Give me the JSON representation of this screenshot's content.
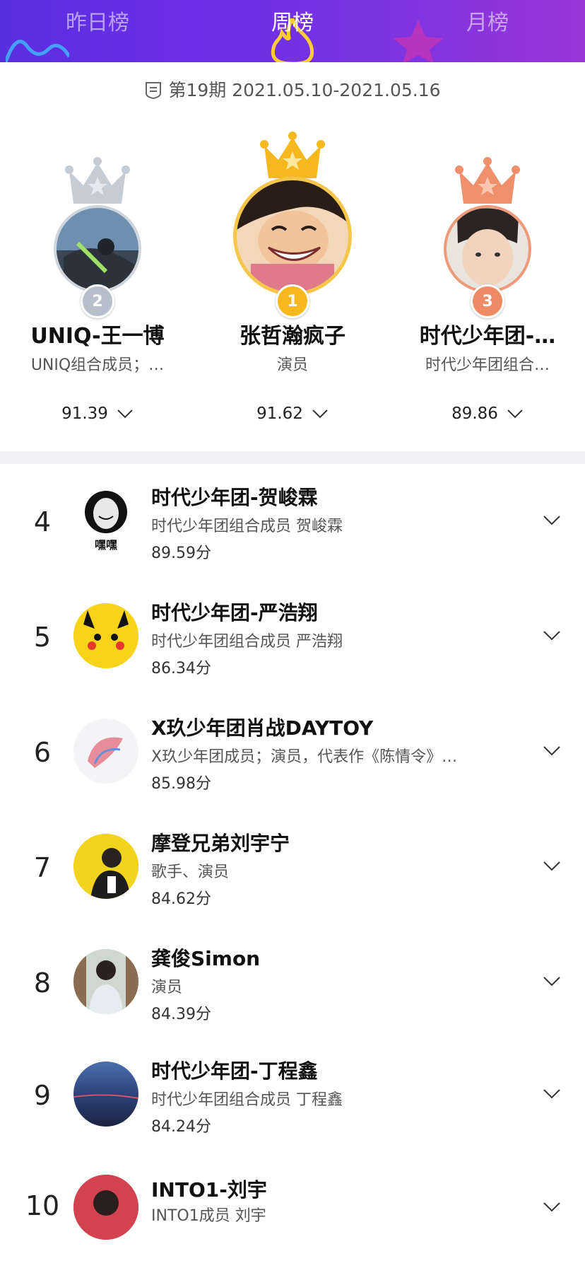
{
  "tabs": [
    {
      "label": "昨日榜",
      "active": false
    },
    {
      "label": "周榜",
      "active": true
    },
    {
      "label": "月榜",
      "active": false
    }
  ],
  "period": {
    "text": "第19期 2021.05.10-2021.05.16"
  },
  "podium": {
    "first": {
      "rank": "1",
      "name": "张哲瀚疯子",
      "desc": "演员",
      "score": "91.62"
    },
    "second": {
      "rank": "2",
      "name": "UNIQ-王一博",
      "desc": "UNIQ组合成员；…",
      "score": "91.39"
    },
    "third": {
      "rank": "3",
      "name": "时代少年团-…",
      "desc": "时代少年团组合…",
      "score": "89.86"
    }
  },
  "list": [
    {
      "rank": "4",
      "name": "时代少年团-贺峻霖",
      "desc": "时代少年团组合成员 贺峻霖",
      "score": "89.59分",
      "avatar_text": "嘿嘿"
    },
    {
      "rank": "5",
      "name": "时代少年团-严浩翔",
      "desc": "时代少年团组合成员 严浩翔",
      "score": "86.34分"
    },
    {
      "rank": "6",
      "name": "X玖少年团肖战DAYTOY",
      "desc": "X玖少年团成员；演员，代表作《陈情令》…",
      "score": "85.98分"
    },
    {
      "rank": "7",
      "name": "摩登兄弟刘宇宁",
      "desc": "歌手、演员",
      "score": "84.62分"
    },
    {
      "rank": "8",
      "name": "龚俊Simon",
      "desc": "演员",
      "score": "84.39分"
    },
    {
      "rank": "9",
      "name": "时代少年团-丁程鑫",
      "desc": "时代少年团组合成员 丁程鑫",
      "score": "84.24分"
    },
    {
      "rank": "10",
      "name": "INTO1-刘宇",
      "desc": "INTO1成员 刘宇",
      "score": ""
    }
  ],
  "colors": {
    "header_start": "#5a2fe0",
    "header_end": "#9b35d6",
    "gold": "#f5b81e",
    "silver": "#b8c0cc",
    "bronze": "#ee8a66"
  },
  "icons": {
    "period": "calendar-flag-icon",
    "expand": "chevron-down-icon",
    "crown": "crown-icon"
  }
}
